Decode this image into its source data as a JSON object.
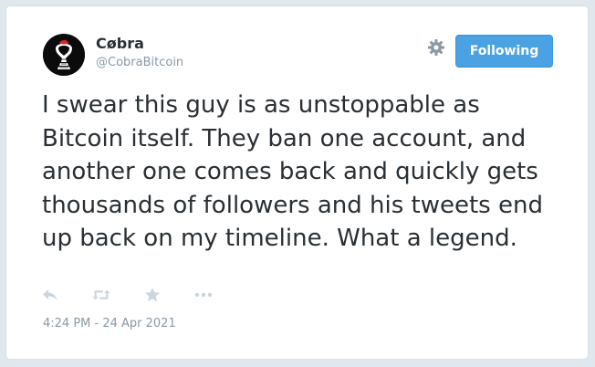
{
  "author": {
    "display_name": "Cøbra",
    "handle": "@CobraBitcoin",
    "avatar_icon": "cobra-avatar-icon"
  },
  "header": {
    "follow_label": "Following",
    "settings_icon": "gear-icon"
  },
  "tweet": {
    "text": "I swear this guy is as unstoppable as Bitcoin itself. They ban one account, and another one comes back and quickly gets thousands of followers and his tweets end up back on my timeline. What a legend.",
    "timestamp": "4:24 PM - 24 Apr 2021"
  },
  "actions": [
    {
      "name": "reply-icon"
    },
    {
      "name": "retweet-icon"
    },
    {
      "name": "favorite-icon"
    },
    {
      "name": "more-icon"
    }
  ],
  "colors": {
    "background": "#e1e8ed",
    "card": "#ffffff",
    "text": "#292f33",
    "muted": "#8899a6",
    "accent": "#4aa2e3",
    "icon": "#ccd6dd"
  }
}
